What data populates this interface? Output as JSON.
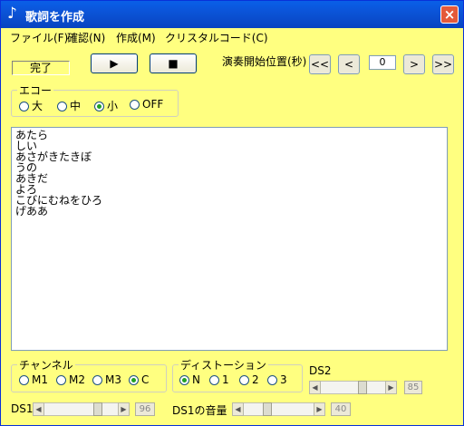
{
  "window": {
    "title": "歌詞を作成",
    "title_icon": "♪",
    "close_label": "×"
  },
  "menu": [
    "ファイル(F)",
    "確認(N)",
    "作成(M)",
    "クリスタルコード(C)"
  ],
  "status": "完了",
  "toolbar": {
    "play_icon": "▶",
    "stop_icon": "■"
  },
  "position": {
    "label": "演奏開始位置(秒)",
    "value": "0",
    "first": "<<",
    "prev": "<",
    "next": ">",
    "last": ">>"
  },
  "echo": {
    "legend": "エコー",
    "options": [
      "大",
      "中",
      "小",
      "OFF"
    ],
    "selected": "小"
  },
  "lyrics": "あたら\nしい\nあさがきたきぼ\nうの\nあきだ\nよろ\nこびにむねをひろ\nげああ",
  "channel": {
    "legend": "チャンネル",
    "options": [
      "M1",
      "M2",
      "M3",
      "C"
    ],
    "selected": "C"
  },
  "distortion": {
    "legend": "ディストーション",
    "options": [
      "N",
      "1",
      "2",
      "3"
    ],
    "selected": "N"
  },
  "ds1": {
    "label": "DS1",
    "value": "96",
    "level": 0.76
  },
  "ds1_volume": {
    "label": "DS1の音量",
    "value": "40",
    "level": 0.31
  },
  "ds2": {
    "label": "DS2",
    "value": "85",
    "level": 0.67
  }
}
